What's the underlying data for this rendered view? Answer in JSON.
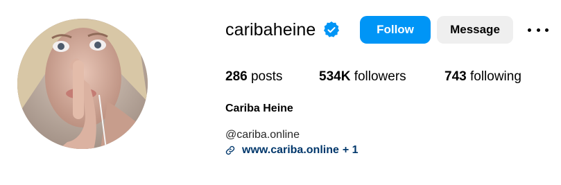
{
  "profile": {
    "username": "caribaheine",
    "verified": true,
    "full_name": "Cariba Heine",
    "handle": "@cariba.online",
    "link_text": "www.cariba.online",
    "link_extra": "+ 1"
  },
  "actions": {
    "follow_label": "Follow",
    "message_label": "Message"
  },
  "stats": {
    "posts_count": "286",
    "posts_label": "posts",
    "followers_count": "534K",
    "followers_label": "followers",
    "following_count": "743",
    "following_label": "following"
  },
  "colors": {
    "follow_button": "#0095f6",
    "message_button": "#efefef",
    "verified_badge": "#0095f6",
    "link": "#00376b"
  },
  "icons": {
    "verified": "verified-badge-icon",
    "more": "more-options-icon",
    "link": "link-icon"
  }
}
